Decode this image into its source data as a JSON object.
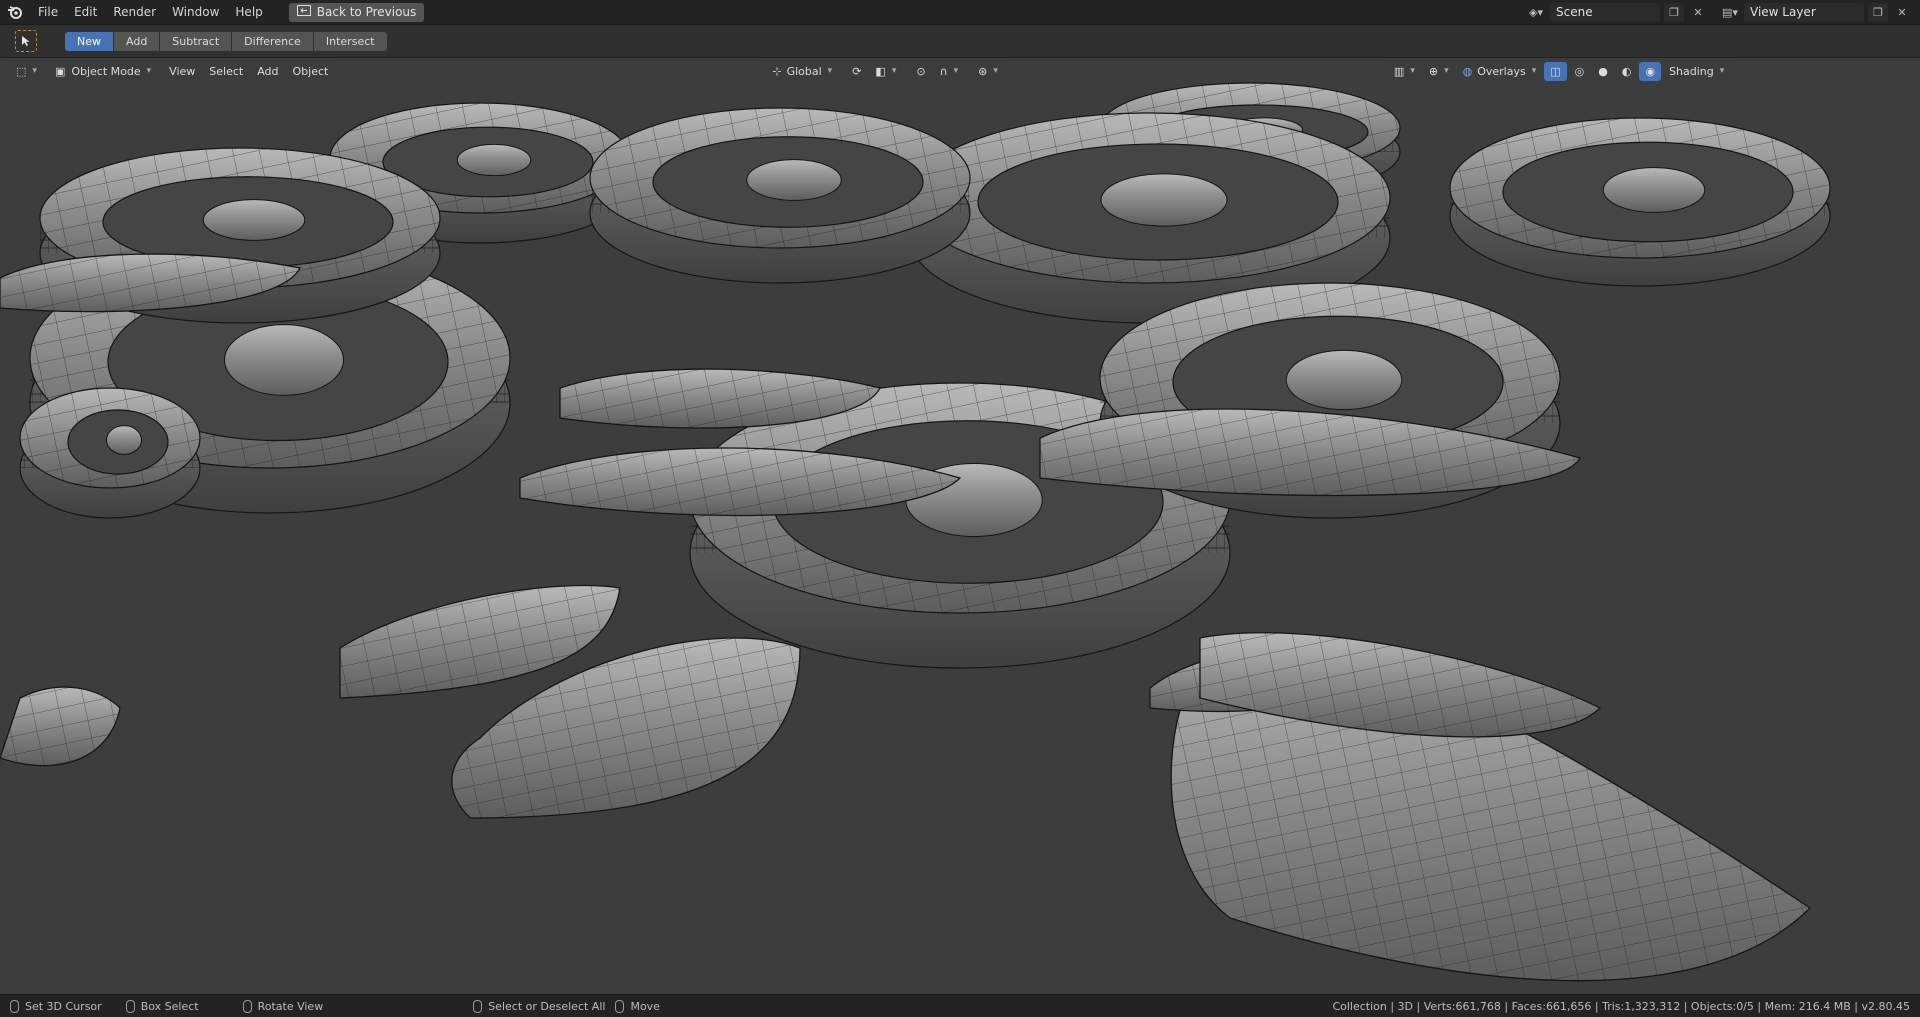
{
  "menubar": {
    "items": [
      "File",
      "Edit",
      "Render",
      "Window",
      "Help"
    ],
    "back_label": "Back to Previous",
    "scene": "Scene",
    "view_layer": "View Layer"
  },
  "tool_header": {
    "buttons": [
      "New",
      "Add",
      "Subtract",
      "Difference",
      "Intersect"
    ],
    "active": "New"
  },
  "viewport_header": {
    "mode": "Object Mode",
    "menus": [
      "View",
      "Select",
      "Add",
      "Object"
    ],
    "transform_orientation": "Global",
    "overlays_label": "Overlays",
    "shading_label": "Shading"
  },
  "statusbar": {
    "hints": [
      "Set 3D Cursor",
      "Box Select",
      "Rotate View",
      "Select or Deselect All",
      "Move"
    ],
    "stats": "Collection | 3D | Verts:661,768 | Faces:661,656 | Tris:1,323,312 | Objects:0/5 | Mem: 216.4 MB | v2.80.45"
  },
  "colors": {
    "accent": "#4772b3",
    "background": "#3d3d3d",
    "mesh": "#8a8a8a"
  },
  "icons": [
    "blender-logo-icon",
    "back-icon",
    "scene-icon",
    "copy-icon",
    "close-icon",
    "view-layer-icon",
    "select-box-icon",
    "editor-type-icon",
    "object-mode-icon",
    "transform-icon",
    "snap-icon",
    "proportional-icon",
    "gizmo-icon",
    "overlay-icon",
    "xray-icon",
    "wireframe-icon",
    "solid-icon",
    "material-icon",
    "rendered-icon"
  ]
}
